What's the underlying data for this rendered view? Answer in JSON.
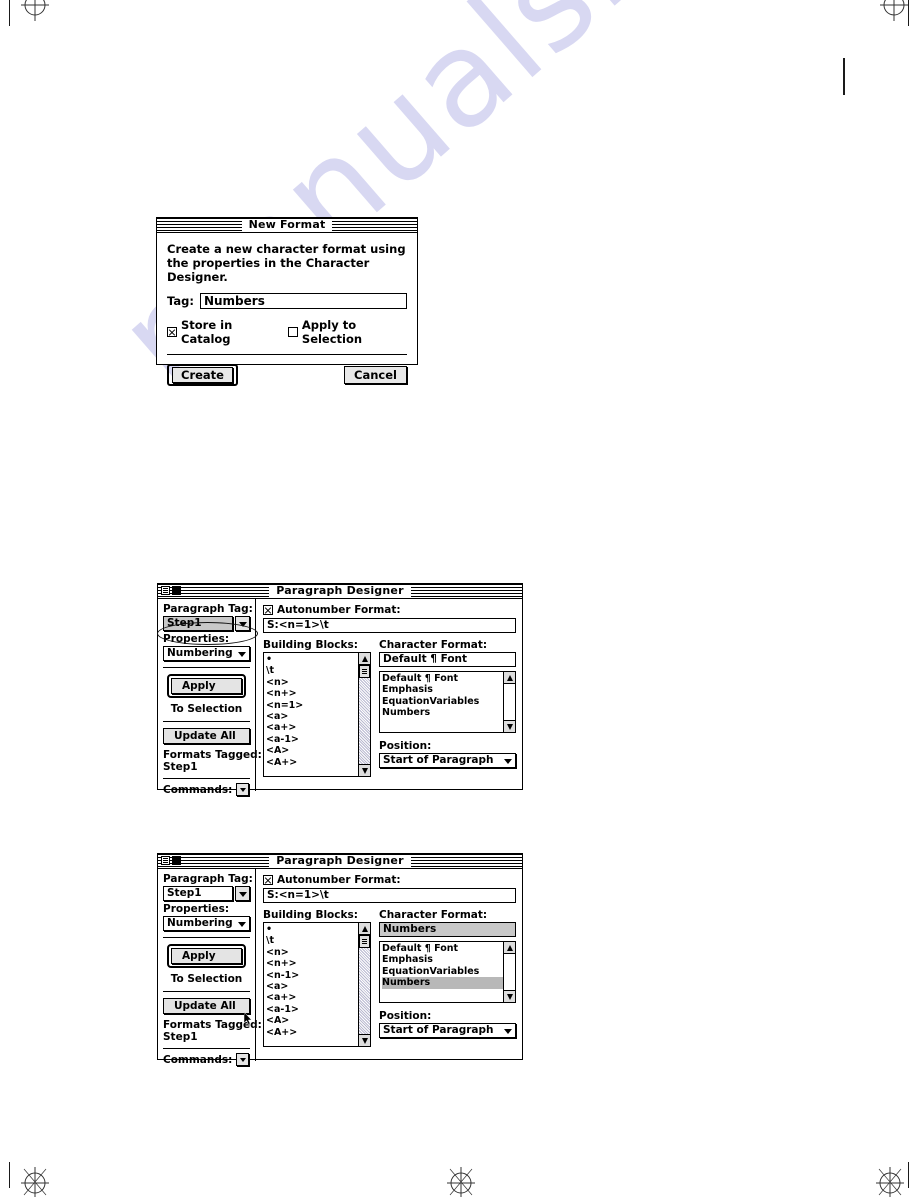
{
  "page": {
    "watermark": "manualshive.com",
    "registration_marks": 5
  },
  "new_format_dialog": {
    "title": "New Format",
    "description": "Create a new character format using the properties in the Character Designer.",
    "tag_label": "Tag:",
    "tag_value": "Numbers",
    "checkboxes": [
      {
        "label": "Store in Catalog",
        "checked": true
      },
      {
        "label": "Apply to Selection",
        "checked": false
      }
    ],
    "create_button": "Create",
    "cancel_button": "Cancel"
  },
  "paragraph_designer_1": {
    "title": "Paragraph Designer",
    "paragraph_tag_label": "Paragraph Tag:",
    "paragraph_tag_value": "Step1",
    "properties_label": "Properties:",
    "properties_value": "Numbering",
    "apply_button": "Apply",
    "to_selection_label": "To Selection",
    "update_all_button": "Update All",
    "formats_tagged_label": "Formats Tagged:",
    "formats_tagged_value": "Step1",
    "commands_label": "Commands:",
    "autonumber_label": "Autonumber Format:",
    "autonumber_checked": true,
    "autonumber_value": "S:<n=1>\\t",
    "building_blocks_label": "Building Blocks:",
    "building_blocks": [
      "•",
      "\\t",
      "<n>",
      "<n+>",
      "<n=1>",
      "<a>",
      "<a+>",
      "<a-1>",
      "<A>",
      "<A+>"
    ],
    "character_format_label": "Character Format:",
    "character_format_value": "Default ¶ Font",
    "character_format_selected": null,
    "character_formats": [
      "Default ¶ Font",
      "Emphasis",
      "EquationVariables",
      "Numbers"
    ],
    "position_label": "Position:",
    "position_value": "Start of Paragraph",
    "annotation_ellipse_on": "properties_value"
  },
  "paragraph_designer_2": {
    "title": "Paragraph Designer",
    "paragraph_tag_label": "Paragraph Tag:",
    "paragraph_tag_value": "Step1",
    "properties_label": "Properties:",
    "properties_value": "Numbering",
    "apply_button": "Apply",
    "to_selection_label": "To Selection",
    "update_all_button": "Update All",
    "formats_tagged_label": "Formats Tagged:",
    "formats_tagged_value": "Step1",
    "commands_label": "Commands:",
    "autonumber_label": "Autonumber Format:",
    "autonumber_checked": true,
    "autonumber_value": "S:<n=1>\\t",
    "building_blocks_label": "Building Blocks:",
    "building_blocks": [
      "•",
      "\\t",
      "<n>",
      "<n+>",
      "<n-1>",
      "<a>",
      "<a+>",
      "<a-1>",
      "<A>",
      "<A+>"
    ],
    "character_format_label": "Character Format:",
    "character_format_value": "Numbers",
    "character_format_selected": "Numbers",
    "character_formats": [
      "Default ¶ Font",
      "Emphasis",
      "EquationVariables",
      "Numbers"
    ],
    "position_label": "Position:",
    "position_value": "Start of Paragraph",
    "cursor_visible": true
  },
  "colors": {
    "window_bg": "#ffffff",
    "border": "#000000",
    "selection_gray": "#b8b8b8",
    "button_face": "#e4e4e4",
    "popup_gray": "#c8c8c8",
    "watermark": "#d8d8f2"
  }
}
